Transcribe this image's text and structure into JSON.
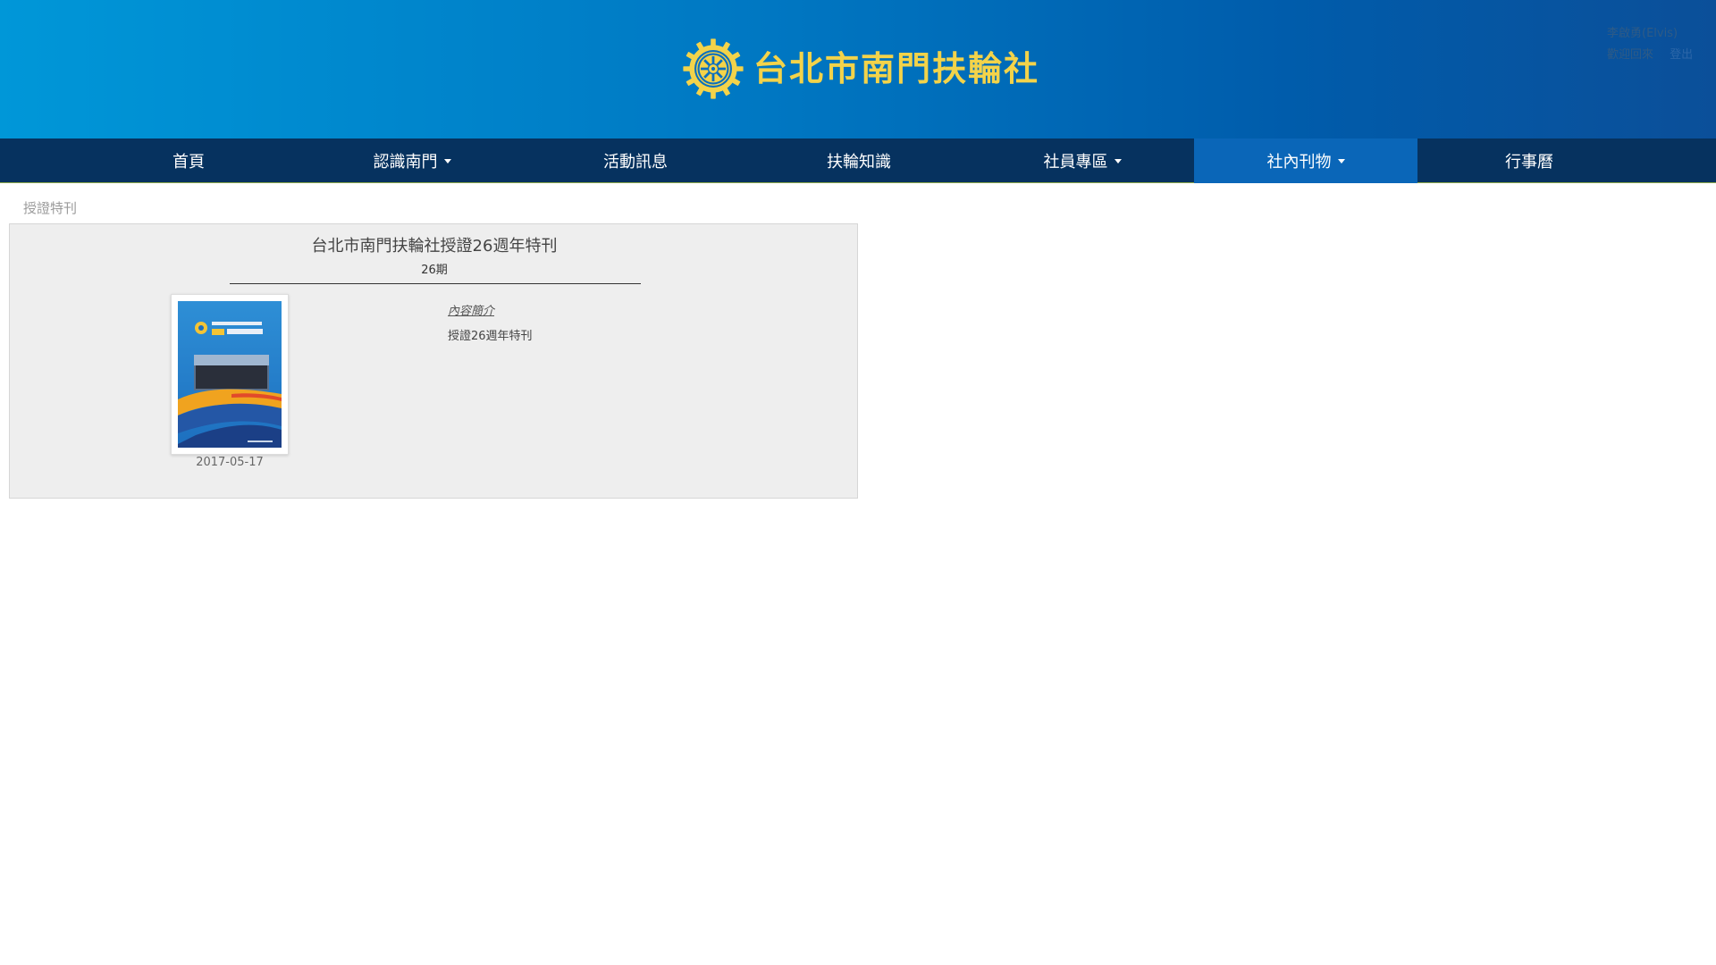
{
  "header": {
    "site_title": "台北市南門扶輪社",
    "logo_icon": "rotary-wheel-icon",
    "logo_color": "#f3d34a",
    "user_name": "李啟勇(Elvis)",
    "welcome": "歡迎回來",
    "logout": "登出"
  },
  "nav": {
    "items": [
      {
        "label": "首頁",
        "dropdown": false
      },
      {
        "label": "認識南門",
        "dropdown": true
      },
      {
        "label": "活動訊息",
        "dropdown": false
      },
      {
        "label": "扶輪知識",
        "dropdown": false
      },
      {
        "label": "社員專區",
        "dropdown": true
      },
      {
        "label": "社內刊物",
        "dropdown": true,
        "active": true
      },
      {
        "label": "行事曆",
        "dropdown": false
      }
    ],
    "bg_color": "#06325f",
    "active_color": "#0a66b8"
  },
  "breadcrumb": "授證特刊",
  "publication": {
    "title": "台北市南門扶輪社授證26週年特刊",
    "issue": "26期",
    "date": "2017-05-17",
    "summary_label": "內容簡介",
    "summary_text": "授證26週年特刊",
    "cover_icon": "magazine-cover-image"
  }
}
